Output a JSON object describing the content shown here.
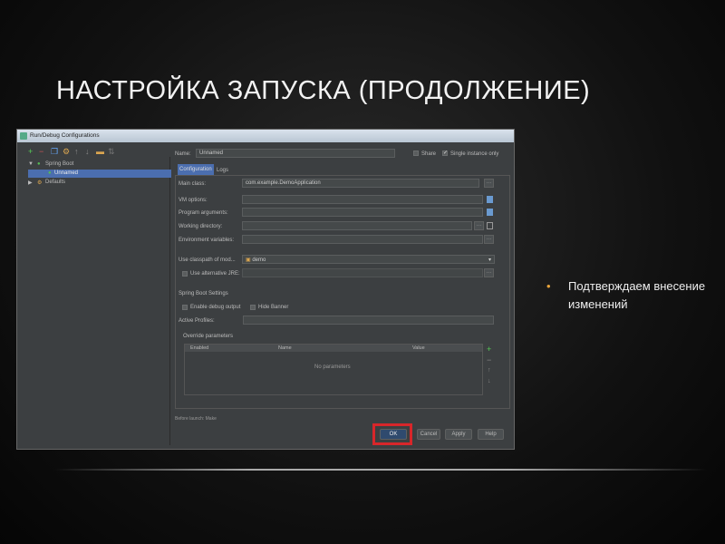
{
  "slide": {
    "title": "НАСТРОЙКА ЗАПУСКА (ПРОДОЛЖЕНИЕ)",
    "bullet": "Подтверждаем внесение изменений",
    "bullet_color": "#e8a33a"
  },
  "dialog": {
    "title": "Run/Debug Configurations",
    "toolbar": [
      "add-icon",
      "remove-icon",
      "copy-icon",
      "wrench-icon",
      "move-up-icon",
      "move-down-icon",
      "folder-icon",
      "sort-icon"
    ],
    "tree": {
      "group": "Spring Boot",
      "child": "Unnamed",
      "defaults": "Defaults"
    },
    "name_label": "Name:",
    "name_value": "Unnamed",
    "share": "Share",
    "single_instance": "Single instance only",
    "tabs": [
      "Configuration",
      "Logs"
    ],
    "fields": {
      "main_class": "Main class:",
      "main_class_value": "com.example.DemoApplication",
      "vm_options": "VM options:",
      "program_arguments": "Program arguments:",
      "working_directory": "Working directory:",
      "environment_variables": "Environment variables:",
      "classpath": "Use classpath of mod...",
      "classpath_value": "demo",
      "alt_jre": "Use alternative JRE:"
    },
    "spring": {
      "section": "Spring Boot Settings",
      "debug": "Enable debug output",
      "banner": "Hide Banner",
      "profiles": "Active Profiles:",
      "override": "Override parameters",
      "columns": [
        "Enabled",
        "Name",
        "Value"
      ],
      "empty": "No parameters"
    },
    "before_launch": "Before launch: Make",
    "buttons": {
      "ok": "OK",
      "cancel": "Cancel",
      "apply": "Apply",
      "help": "Help"
    },
    "highlight_color": "#d8262a"
  }
}
